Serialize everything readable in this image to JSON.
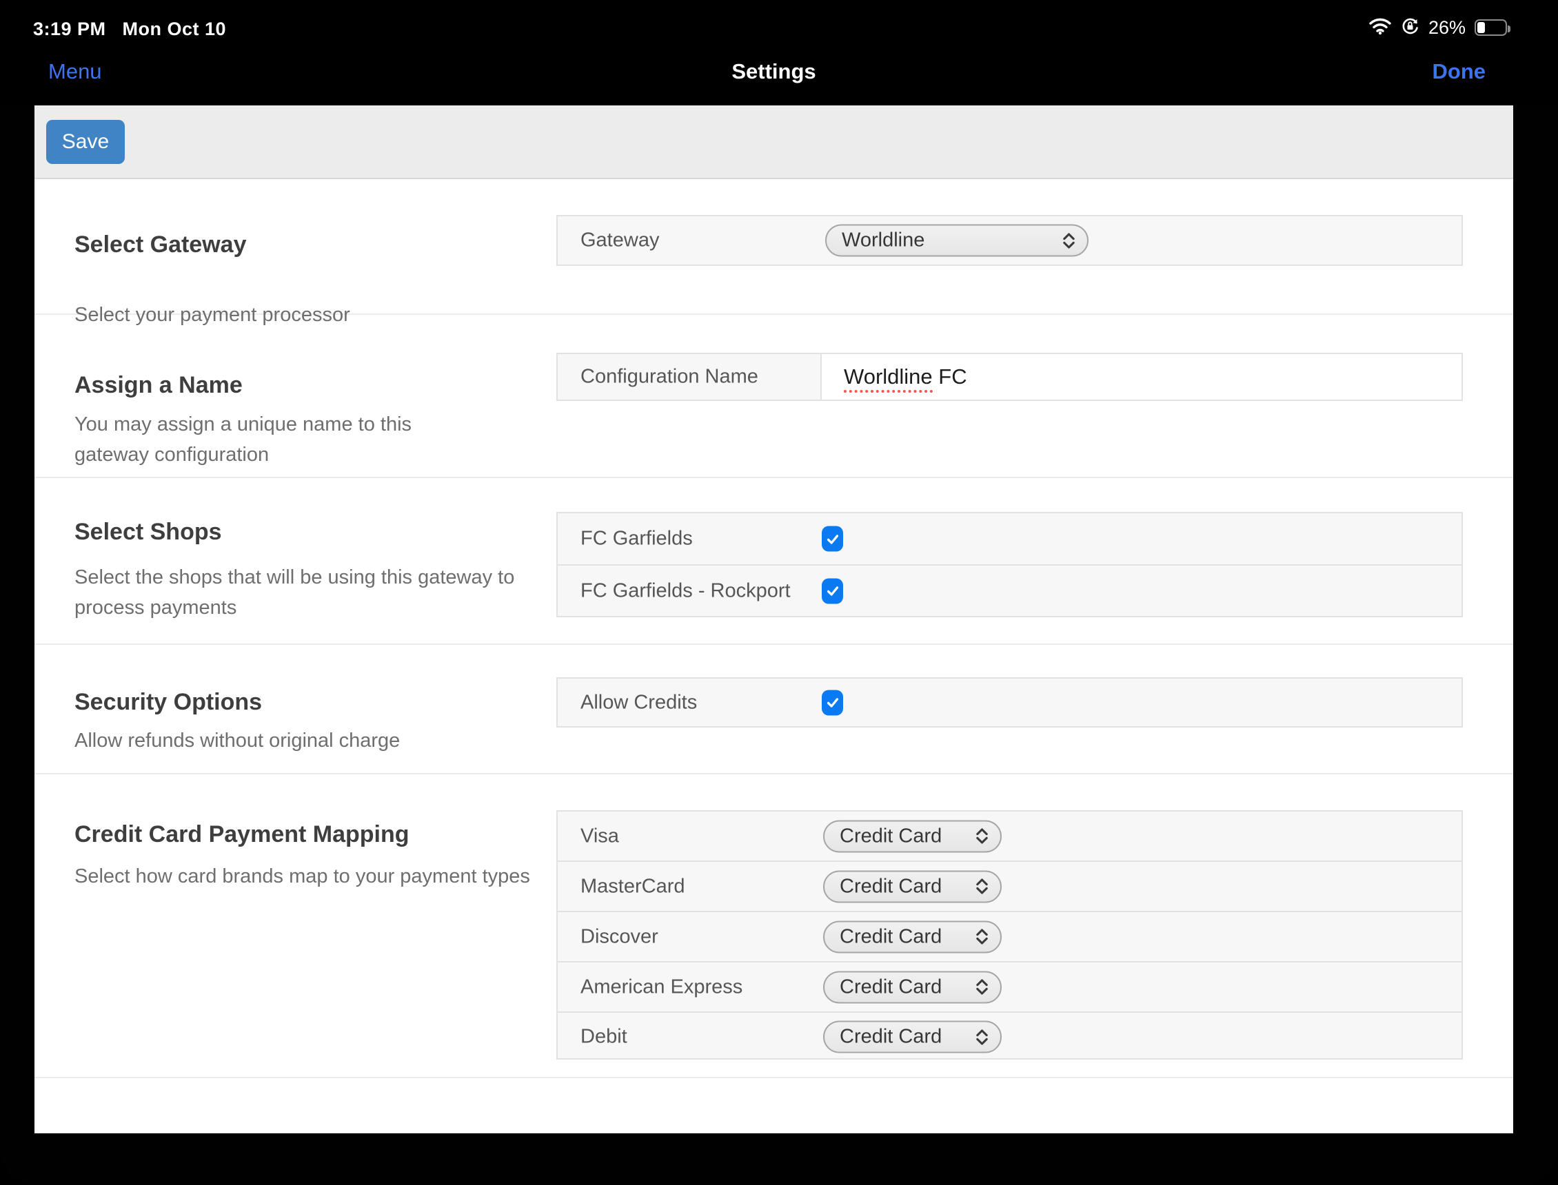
{
  "status_bar": {
    "time": "3:19 PM",
    "date": "Mon Oct 10",
    "battery_percent": "26%",
    "icons": {
      "wifi": "wifi-icon",
      "orientation_lock": "orientation-lock-icon",
      "battery": "battery-icon"
    }
  },
  "nav_bar": {
    "menu_label": "Menu",
    "title": "Settings",
    "done_label": "Done"
  },
  "toolbar": {
    "save_label": "Save"
  },
  "colors": {
    "nav_accent_blue": "#3d74ed",
    "save_button_blue": "#4084c6",
    "checkbox_blue": "#0a7af2",
    "row_background": "#f7f7f7",
    "spellcheck_red": "#f8564e"
  },
  "sections": [
    {
      "heading": "Select Gateway",
      "description": "Select your payment processor",
      "row": {
        "label": "Gateway",
        "select_value": "Worldline"
      }
    },
    {
      "heading": "Assign a Name",
      "description": "You may assign a unique name to this gateway configuration",
      "row": {
        "label": "Configuration Name",
        "input_value": "Worldline FC",
        "input_value_misspelled": "Worldline",
        "input_value_rest": " FC"
      }
    },
    {
      "heading": "Select Shops",
      "description": "Select the shops that will be using this gateway to process payments",
      "rows": [
        {
          "label": "FC Garfields",
          "checked": true
        },
        {
          "label": "FC Garfields - Rockport",
          "checked": true
        }
      ]
    },
    {
      "heading": "Security Options",
      "description": "Allow refunds without original charge",
      "rows": [
        {
          "label": "Allow Credits",
          "checked": true
        }
      ]
    },
    {
      "heading": "Credit Card Payment Mapping",
      "description": "Select how card brands map to your payment types",
      "rows": [
        {
          "label": "Visa",
          "select_value": "Credit Card"
        },
        {
          "label": "MasterCard",
          "select_value": "Credit Card"
        },
        {
          "label": "Discover",
          "select_value": "Credit Card"
        },
        {
          "label": "American Express",
          "select_value": "Credit Card"
        },
        {
          "label": "Debit",
          "select_value": "Credit Card"
        }
      ]
    }
  ]
}
